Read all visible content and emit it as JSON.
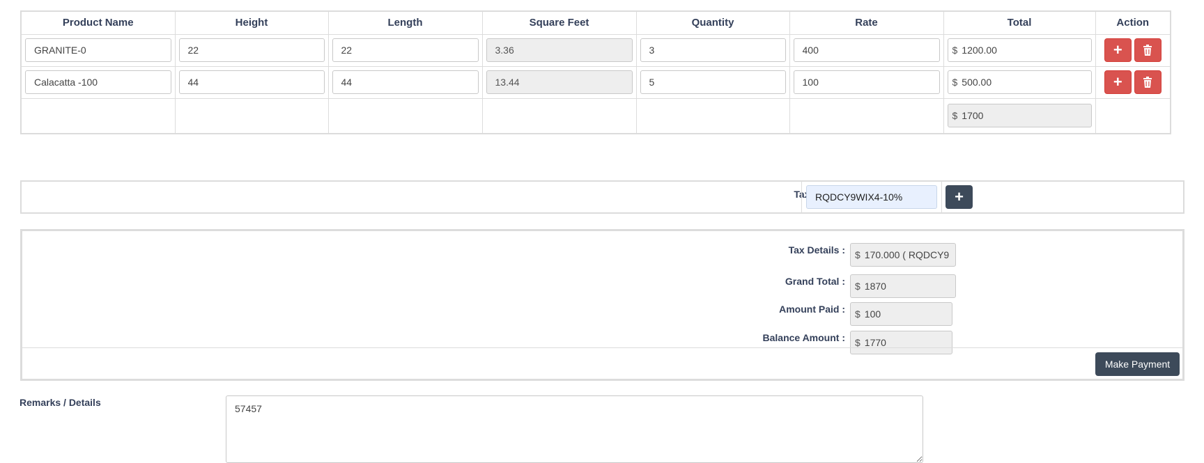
{
  "table": {
    "headers": [
      "Product Name",
      "Height",
      "Length",
      "Square Feet",
      "Quantity",
      "Rate",
      "Total",
      "Action"
    ],
    "rows": [
      {
        "product": "GRANITE-0",
        "height": "22",
        "length": "22",
        "sqft": "3.36",
        "quantity": "3",
        "rate": "400",
        "total": "1200.00"
      },
      {
        "product": "Calacatta -100",
        "height": "44",
        "length": "44",
        "sqft": "13.44",
        "quantity": "5",
        "rate": "100",
        "total": "500.00"
      }
    ],
    "footer_total": "1700",
    "currency": "$",
    "add_glyph": "+",
    "delete_icon": "trash-icon"
  },
  "tax": {
    "label": "Tax :",
    "value": "RQDCY9WIX4-10%",
    "add_glyph": "+"
  },
  "summary": {
    "currency": "$",
    "tax_details_label": "Tax Details :",
    "tax_details_value": "170.000 ( RQDCY9",
    "grand_total_label": "Grand Total :",
    "grand_total_value": "1870",
    "amount_paid_label": "Amount Paid :",
    "amount_paid_value": "100",
    "balance_label": "Balance Amount :",
    "balance_value": "1770",
    "make_payment_label": "Make Payment"
  },
  "remarks": {
    "label": "Remarks / Details",
    "value": "57457"
  },
  "colors": {
    "danger": "#d9534f",
    "dark": "#3d4a5a",
    "label": "#34405a",
    "readonly_bg": "#eeeeee"
  }
}
